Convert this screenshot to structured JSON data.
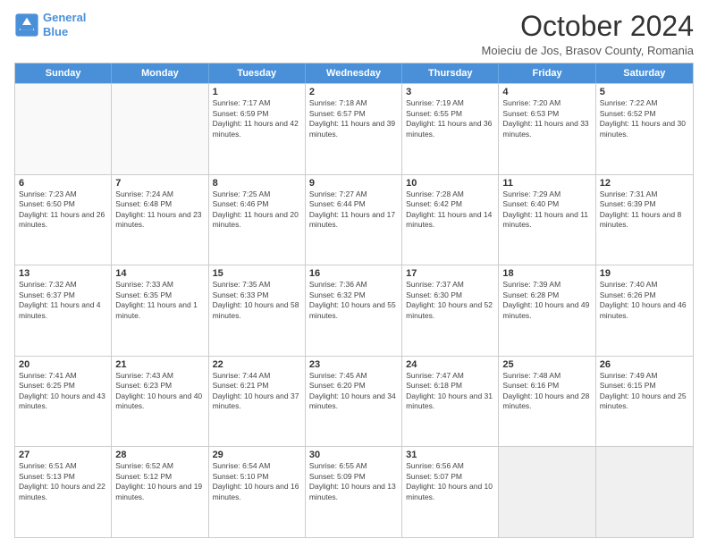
{
  "header": {
    "logo_line1": "General",
    "logo_line2": "Blue",
    "month_title": "October 2024",
    "location": "Moieciu de Jos, Brasov County, Romania"
  },
  "days_of_week": [
    "Sunday",
    "Monday",
    "Tuesday",
    "Wednesday",
    "Thursday",
    "Friday",
    "Saturday"
  ],
  "weeks": [
    [
      {
        "day": "",
        "empty": true
      },
      {
        "day": "",
        "empty": true
      },
      {
        "day": "1",
        "sunrise": "Sunrise: 7:17 AM",
        "sunset": "Sunset: 6:59 PM",
        "daylight": "Daylight: 11 hours and 42 minutes."
      },
      {
        "day": "2",
        "sunrise": "Sunrise: 7:18 AM",
        "sunset": "Sunset: 6:57 PM",
        "daylight": "Daylight: 11 hours and 39 minutes."
      },
      {
        "day": "3",
        "sunrise": "Sunrise: 7:19 AM",
        "sunset": "Sunset: 6:55 PM",
        "daylight": "Daylight: 11 hours and 36 minutes."
      },
      {
        "day": "4",
        "sunrise": "Sunrise: 7:20 AM",
        "sunset": "Sunset: 6:53 PM",
        "daylight": "Daylight: 11 hours and 33 minutes."
      },
      {
        "day": "5",
        "sunrise": "Sunrise: 7:22 AM",
        "sunset": "Sunset: 6:52 PM",
        "daylight": "Daylight: 11 hours and 30 minutes."
      }
    ],
    [
      {
        "day": "6",
        "sunrise": "Sunrise: 7:23 AM",
        "sunset": "Sunset: 6:50 PM",
        "daylight": "Daylight: 11 hours and 26 minutes."
      },
      {
        "day": "7",
        "sunrise": "Sunrise: 7:24 AM",
        "sunset": "Sunset: 6:48 PM",
        "daylight": "Daylight: 11 hours and 23 minutes."
      },
      {
        "day": "8",
        "sunrise": "Sunrise: 7:25 AM",
        "sunset": "Sunset: 6:46 PM",
        "daylight": "Daylight: 11 hours and 20 minutes."
      },
      {
        "day": "9",
        "sunrise": "Sunrise: 7:27 AM",
        "sunset": "Sunset: 6:44 PM",
        "daylight": "Daylight: 11 hours and 17 minutes."
      },
      {
        "day": "10",
        "sunrise": "Sunrise: 7:28 AM",
        "sunset": "Sunset: 6:42 PM",
        "daylight": "Daylight: 11 hours and 14 minutes."
      },
      {
        "day": "11",
        "sunrise": "Sunrise: 7:29 AM",
        "sunset": "Sunset: 6:40 PM",
        "daylight": "Daylight: 11 hours and 11 minutes."
      },
      {
        "day": "12",
        "sunrise": "Sunrise: 7:31 AM",
        "sunset": "Sunset: 6:39 PM",
        "daylight": "Daylight: 11 hours and 8 minutes."
      }
    ],
    [
      {
        "day": "13",
        "sunrise": "Sunrise: 7:32 AM",
        "sunset": "Sunset: 6:37 PM",
        "daylight": "Daylight: 11 hours and 4 minutes."
      },
      {
        "day": "14",
        "sunrise": "Sunrise: 7:33 AM",
        "sunset": "Sunset: 6:35 PM",
        "daylight": "Daylight: 11 hours and 1 minute."
      },
      {
        "day": "15",
        "sunrise": "Sunrise: 7:35 AM",
        "sunset": "Sunset: 6:33 PM",
        "daylight": "Daylight: 10 hours and 58 minutes."
      },
      {
        "day": "16",
        "sunrise": "Sunrise: 7:36 AM",
        "sunset": "Sunset: 6:32 PM",
        "daylight": "Daylight: 10 hours and 55 minutes."
      },
      {
        "day": "17",
        "sunrise": "Sunrise: 7:37 AM",
        "sunset": "Sunset: 6:30 PM",
        "daylight": "Daylight: 10 hours and 52 minutes."
      },
      {
        "day": "18",
        "sunrise": "Sunrise: 7:39 AM",
        "sunset": "Sunset: 6:28 PM",
        "daylight": "Daylight: 10 hours and 49 minutes."
      },
      {
        "day": "19",
        "sunrise": "Sunrise: 7:40 AM",
        "sunset": "Sunset: 6:26 PM",
        "daylight": "Daylight: 10 hours and 46 minutes."
      }
    ],
    [
      {
        "day": "20",
        "sunrise": "Sunrise: 7:41 AM",
        "sunset": "Sunset: 6:25 PM",
        "daylight": "Daylight: 10 hours and 43 minutes."
      },
      {
        "day": "21",
        "sunrise": "Sunrise: 7:43 AM",
        "sunset": "Sunset: 6:23 PM",
        "daylight": "Daylight: 10 hours and 40 minutes."
      },
      {
        "day": "22",
        "sunrise": "Sunrise: 7:44 AM",
        "sunset": "Sunset: 6:21 PM",
        "daylight": "Daylight: 10 hours and 37 minutes."
      },
      {
        "day": "23",
        "sunrise": "Sunrise: 7:45 AM",
        "sunset": "Sunset: 6:20 PM",
        "daylight": "Daylight: 10 hours and 34 minutes."
      },
      {
        "day": "24",
        "sunrise": "Sunrise: 7:47 AM",
        "sunset": "Sunset: 6:18 PM",
        "daylight": "Daylight: 10 hours and 31 minutes."
      },
      {
        "day": "25",
        "sunrise": "Sunrise: 7:48 AM",
        "sunset": "Sunset: 6:16 PM",
        "daylight": "Daylight: 10 hours and 28 minutes."
      },
      {
        "day": "26",
        "sunrise": "Sunrise: 7:49 AM",
        "sunset": "Sunset: 6:15 PM",
        "daylight": "Daylight: 10 hours and 25 minutes."
      }
    ],
    [
      {
        "day": "27",
        "sunrise": "Sunrise: 6:51 AM",
        "sunset": "Sunset: 5:13 PM",
        "daylight": "Daylight: 10 hours and 22 minutes."
      },
      {
        "day": "28",
        "sunrise": "Sunrise: 6:52 AM",
        "sunset": "Sunset: 5:12 PM",
        "daylight": "Daylight: 10 hours and 19 minutes."
      },
      {
        "day": "29",
        "sunrise": "Sunrise: 6:54 AM",
        "sunset": "Sunset: 5:10 PM",
        "daylight": "Daylight: 10 hours and 16 minutes."
      },
      {
        "day": "30",
        "sunrise": "Sunrise: 6:55 AM",
        "sunset": "Sunset: 5:09 PM",
        "daylight": "Daylight: 10 hours and 13 minutes."
      },
      {
        "day": "31",
        "sunrise": "Sunrise: 6:56 AM",
        "sunset": "Sunset: 5:07 PM",
        "daylight": "Daylight: 10 hours and 10 minutes."
      },
      {
        "day": "",
        "empty": true
      },
      {
        "day": "",
        "empty": true
      }
    ]
  ]
}
